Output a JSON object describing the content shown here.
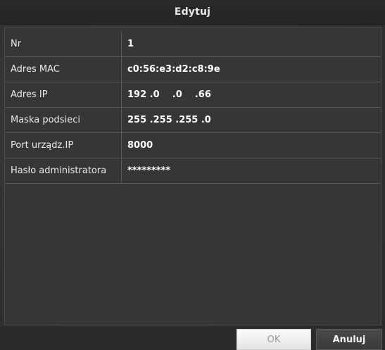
{
  "dialog": {
    "title": "Edytuj"
  },
  "fields": [
    {
      "label": "Nr",
      "value": "1"
    },
    {
      "label": "Adres MAC",
      "value": "c0:56:e3:d2:c8:9e"
    },
    {
      "label": "Adres IP",
      "value": "192 .0    .0    .66"
    },
    {
      "label": "Maska podsieci",
      "value": "255 .255 .255 .0"
    },
    {
      "label": "Port urządz.IP",
      "value": "8000"
    },
    {
      "label": "Hasło administratora",
      "value": "*********"
    }
  ],
  "buttons": {
    "ok_label": "OK",
    "cancel_label": "Anuluj"
  },
  "colors": {
    "background": "#333333",
    "ok_button": "#f0f0f0",
    "cancel_button": "#424242"
  }
}
